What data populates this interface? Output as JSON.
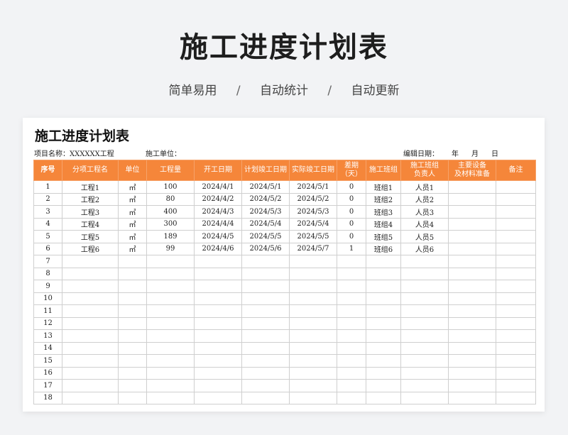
{
  "hero": {
    "title": "施工进度计划表",
    "tags": [
      "简单易用",
      "自动统计",
      "自动更新"
    ],
    "separator": "/"
  },
  "sheet": {
    "title": "施工进度计划表",
    "project_label": "项目名称：XXXXXX工程",
    "unit_label": "施工单位：",
    "date_label": "编辑日期：",
    "date_year": "年",
    "date_month": "月",
    "date_day": "日",
    "header_color": "#f5863a"
  },
  "table": {
    "headers": [
      "序号",
      "分项工程名",
      "单位",
      "工程量",
      "开工日期",
      "计划竣工日期",
      "实际竣工日期",
      "差期\n（天）",
      "施工班组",
      "施工班组\n负责人",
      "主要设备\n及材料准备",
      "备注"
    ],
    "rows": [
      [
        "1",
        "工程1",
        "㎡",
        "100",
        "2024/4/1",
        "2024/5/1",
        "2024/5/1",
        "0",
        "班组1",
        "人员1",
        "",
        ""
      ],
      [
        "2",
        "工程2",
        "㎡",
        "80",
        "2024/4/2",
        "2024/5/2",
        "2024/5/2",
        "0",
        "班组2",
        "人员2",
        "",
        ""
      ],
      [
        "3",
        "工程3",
        "㎥",
        "400",
        "2024/4/3",
        "2024/5/3",
        "2024/5/3",
        "0",
        "班组3",
        "人员3",
        "",
        ""
      ],
      [
        "4",
        "工程4",
        "㎡",
        "300",
        "2024/4/4",
        "2024/5/4",
        "2024/5/4",
        "0",
        "班组4",
        "人员4",
        "",
        ""
      ],
      [
        "5",
        "工程5",
        "㎥",
        "189",
        "2024/4/5",
        "2024/5/5",
        "2024/5/5",
        "0",
        "班组5",
        "人员5",
        "",
        ""
      ],
      [
        "6",
        "工程6",
        "㎡",
        "99",
        "2024/4/6",
        "2024/5/6",
        "2024/5/7",
        "1",
        "班组6",
        "人员6",
        "",
        ""
      ],
      [
        "7",
        "",
        "",
        "",
        "",
        "",
        "",
        "",
        "",
        "",
        "",
        ""
      ],
      [
        "8",
        "",
        "",
        "",
        "",
        "",
        "",
        "",
        "",
        "",
        "",
        ""
      ],
      [
        "9",
        "",
        "",
        "",
        "",
        "",
        "",
        "",
        "",
        "",
        "",
        ""
      ],
      [
        "10",
        "",
        "",
        "",
        "",
        "",
        "",
        "",
        "",
        "",
        "",
        ""
      ],
      [
        "11",
        "",
        "",
        "",
        "",
        "",
        "",
        "",
        "",
        "",
        "",
        ""
      ],
      [
        "12",
        "",
        "",
        "",
        "",
        "",
        "",
        "",
        "",
        "",
        "",
        ""
      ],
      [
        "13",
        "",
        "",
        "",
        "",
        "",
        "",
        "",
        "",
        "",
        "",
        ""
      ],
      [
        "14",
        "",
        "",
        "",
        "",
        "",
        "",
        "",
        "",
        "",
        "",
        ""
      ],
      [
        "15",
        "",
        "",
        "",
        "",
        "",
        "",
        "",
        "",
        "",
        "",
        ""
      ],
      [
        "16",
        "",
        "",
        "",
        "",
        "",
        "",
        "",
        "",
        "",
        "",
        ""
      ],
      [
        "17",
        "",
        "",
        "",
        "",
        "",
        "",
        "",
        "",
        "",
        "",
        ""
      ],
      [
        "18",
        "",
        "",
        "",
        "",
        "",
        "",
        "",
        "",
        "",
        "",
        ""
      ]
    ]
  }
}
